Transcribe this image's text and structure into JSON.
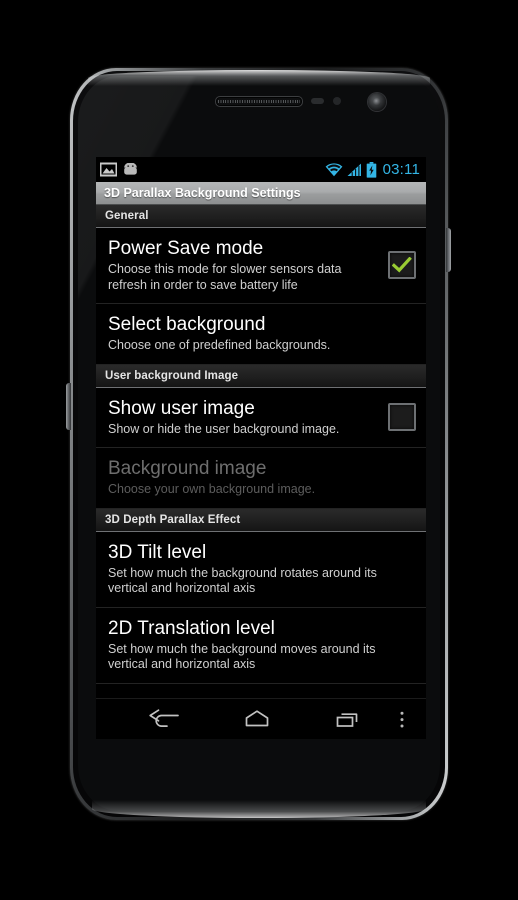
{
  "device": {
    "name": "android-phone-mockup",
    "hardware": {
      "earpiece": "earpiece-speaker",
      "proximity_sensor": "proximity-sensor",
      "light_sensor": "light-sensor",
      "front_camera": "front-camera",
      "volume_button": "volume-button",
      "power_button": "power-button"
    }
  },
  "statusbar": {
    "left_icons": [
      "screenshot-image-icon",
      "android-robot-icon"
    ],
    "right_icons": [
      "wifi-icon",
      "cellular-signal-icon",
      "battery-charging-icon"
    ],
    "clock": "03:11",
    "accent_color": "#33b5e5"
  },
  "titlebar": {
    "title": "3D Parallax Background Settings"
  },
  "sections": [
    {
      "header": "General",
      "items": [
        {
          "title": "Power Save mode",
          "summary": "Choose this mode for slower sensors data refresh in order to save battery life",
          "widget": "checkbox",
          "checked": true,
          "enabled": true,
          "name": "power-save-mode"
        },
        {
          "title": "Select background",
          "summary": "Choose one of predefined backgrounds.",
          "widget": "none",
          "checked": false,
          "enabled": true,
          "name": "select-background"
        }
      ]
    },
    {
      "header": "User background Image",
      "items": [
        {
          "title": "Show user image",
          "summary": "Show or hide the user background image.",
          "widget": "checkbox",
          "checked": false,
          "enabled": true,
          "name": "show-user-image"
        },
        {
          "title": "Background image",
          "summary": "Choose your own background image.",
          "widget": "none",
          "checked": false,
          "enabled": false,
          "name": "background-image"
        }
      ]
    },
    {
      "header": "3D Depth Parallax Effect",
      "items": [
        {
          "title": "3D Tilt level",
          "summary": "Set how much the background rotates around its vertical and horizontal axis",
          "widget": "none",
          "checked": false,
          "enabled": true,
          "name": "3d-tilt-level"
        },
        {
          "title": "2D Translation level",
          "summary": "Set how much the background moves around its vertical and horizontal axis",
          "widget": "none",
          "checked": false,
          "enabled": true,
          "name": "2d-translation-level"
        }
      ]
    }
  ],
  "navbar": {
    "buttons": [
      {
        "name": "back-icon",
        "label": "Back"
      },
      {
        "name": "home-icon",
        "label": "Home"
      },
      {
        "name": "recents-icon",
        "label": "Recent apps"
      },
      {
        "name": "overflow-menu-icon",
        "label": "Menu"
      }
    ]
  },
  "colors": {
    "checkmark_green": "#99cc33",
    "status_accent": "#33b5e5",
    "titlebar_text": "#ffffff",
    "screen_background": "#000000"
  }
}
